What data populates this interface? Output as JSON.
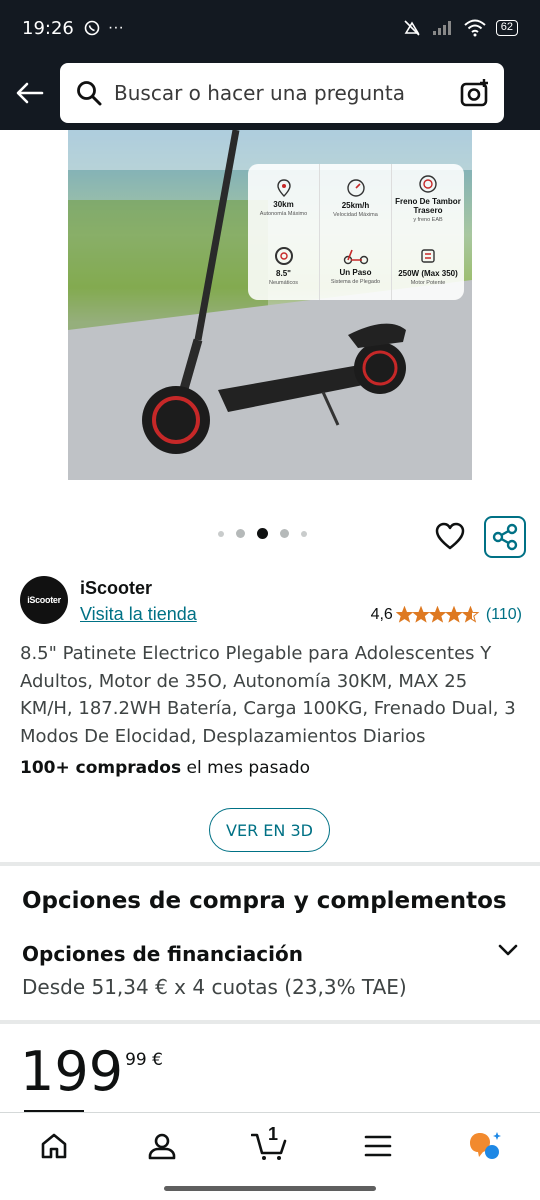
{
  "status_bar": {
    "time": "19:26",
    "battery": "62"
  },
  "search": {
    "placeholder": "Buscar o hacer una pregunta"
  },
  "hero": {
    "specs": [
      {
        "icon": "location-pin-icon",
        "value": "30km",
        "sub": "Autonomía Máximo"
      },
      {
        "icon": "speedometer-icon",
        "value": "25km/h",
        "sub": "Velocidad Máxima"
      },
      {
        "icon": "brake-drum-icon",
        "value": "Freno De Tambor Trasero",
        "sub": "y freno EAB"
      },
      {
        "icon": "tire-icon",
        "value": "8.5\"",
        "sub": "Neumáticos"
      },
      {
        "icon": "scooter-icon",
        "value": "Un Paso",
        "sub": "Sistema de Plegado"
      },
      {
        "icon": "motor-icon",
        "value": "250W (Max 350)",
        "sub": "Motor Potente"
      }
    ],
    "carousel_active_index": 2,
    "carousel_count": 5
  },
  "store": {
    "logo_text": "iScooter",
    "name": "iScooter",
    "link": "Visita la tienda",
    "rating": "4,6",
    "rating_value": 4.6,
    "review_count": "(110)"
  },
  "product": {
    "title": "8.5\" Patinete Electrico Plegable para Adolescentes Y Adultos, Motor de 35O, Autonomía 30KM, MAX 25 KM/H, 187.2WH Batería, Carga 100KG, Frenado Dual, 3 Modos De Elocidad, Desplazamientos Diarios",
    "bought_bold": "100+ comprados",
    "bought_rest": " el mes pasado",
    "view_3d": "VER EN 3D"
  },
  "purchase": {
    "section_title": "Opciones de compra y complementos",
    "financing_title": "Opciones de financiación",
    "financing_sub": "Desde 51,34 € x 4 cuotas (23,3% TAE)"
  },
  "price": {
    "whole": "199",
    "fraction": "99 €"
  },
  "nav": {
    "cart_count": "1",
    "items": [
      "home-icon",
      "account-icon",
      "cart-icon",
      "menu-icon",
      "rufus-icon"
    ]
  },
  "colors": {
    "header": "#131921",
    "link": "#007185",
    "star": "#de7921"
  }
}
